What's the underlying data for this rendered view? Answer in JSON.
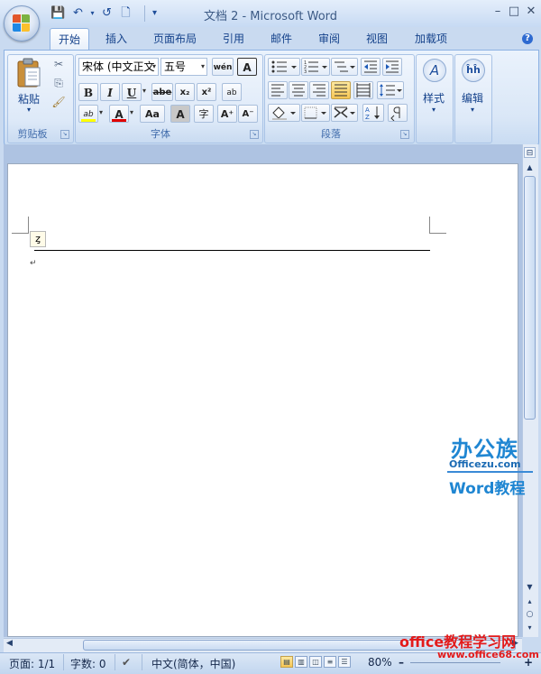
{
  "window": {
    "title": "文档 2 - Microsoft Word",
    "controls": {
      "minimize": "–",
      "maximize": "□",
      "close": "✕"
    }
  },
  "quick_access": {
    "save": "💾",
    "undo": "↶",
    "redo": "↺",
    "new": "🗋",
    "customize": "▾"
  },
  "tabs": [
    {
      "label": "开始",
      "active": true
    },
    {
      "label": "插入"
    },
    {
      "label": "页面布局"
    },
    {
      "label": "引用"
    },
    {
      "label": "邮件"
    },
    {
      "label": "审阅"
    },
    {
      "label": "视图"
    },
    {
      "label": "加载项"
    }
  ],
  "help": "?",
  "ribbon": {
    "clipboard": {
      "caption": "剪贴板",
      "paste_label": "粘贴",
      "cut": "✂",
      "copy": "⎘",
      "format_painter": "🖌"
    },
    "font": {
      "caption": "字体",
      "font_name": "宋体 (中文正文",
      "font_size": "五号",
      "clear_format": "wén",
      "char_border": "A",
      "bold": "B",
      "italic": "I",
      "underline": "U",
      "strike": "abe",
      "subscript": "x₂",
      "superscript": "x²",
      "phonetic": "ab",
      "highlight": "ab",
      "font_color": "A",
      "change_case": "Aa",
      "char_shading": "A",
      "enclose": "字",
      "grow": "A⁺",
      "shrink": "A⁻",
      "highlight_color": "#ffff00",
      "font_color_value": "#e00000"
    },
    "paragraph": {
      "caption": "段落"
    },
    "styles": {
      "label": "样式"
    },
    "editing": {
      "label": "编辑"
    }
  },
  "document": {
    "anchor_icon": "ȥ",
    "paragraph_mark": "↵"
  },
  "statusbar": {
    "page": "页面: 1/1",
    "words": "字数: 0",
    "language": "中文(简体，中国)",
    "zoom": "80%",
    "zoom_minus": "–",
    "zoom_plus": "+"
  },
  "watermarks": {
    "brand_top": "办公族",
    "brand_url": "Officezu.com",
    "brand_sub": "Word教程",
    "bottom": "office教程学习网",
    "bottom_url": "www.office68.com"
  }
}
